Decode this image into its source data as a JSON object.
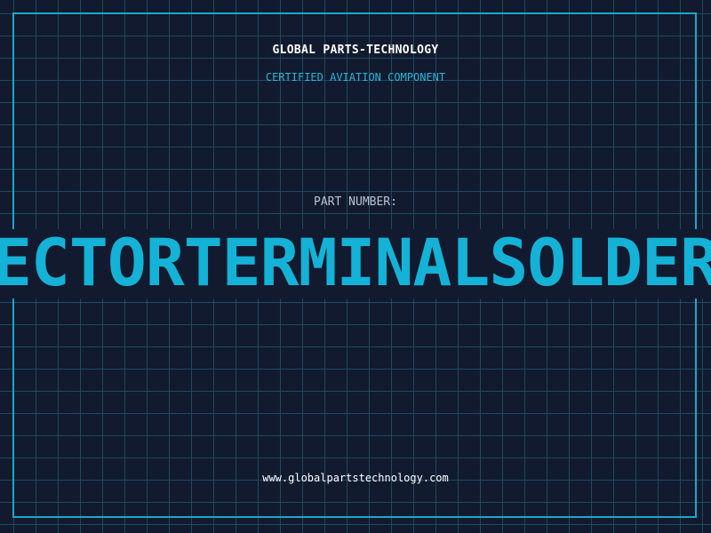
{
  "header": {
    "brand": "GLOBAL PARTS-TECHNOLOGY",
    "subtitle": "CERTIFIED AVIATION COMPONENT"
  },
  "part": {
    "label": "PART NUMBER:",
    "visible_number_text": "ECTORTERMINALSOLDER"
  },
  "footer": {
    "url": "www.globalpartstechnology.com"
  },
  "colors": {
    "background": "#111a2e",
    "grid": "#1e4a5f",
    "accent": "#1aa7cc",
    "part_number": "#14b2d6",
    "brand_text": "#ffffff",
    "label_text": "#b9c4d4"
  }
}
